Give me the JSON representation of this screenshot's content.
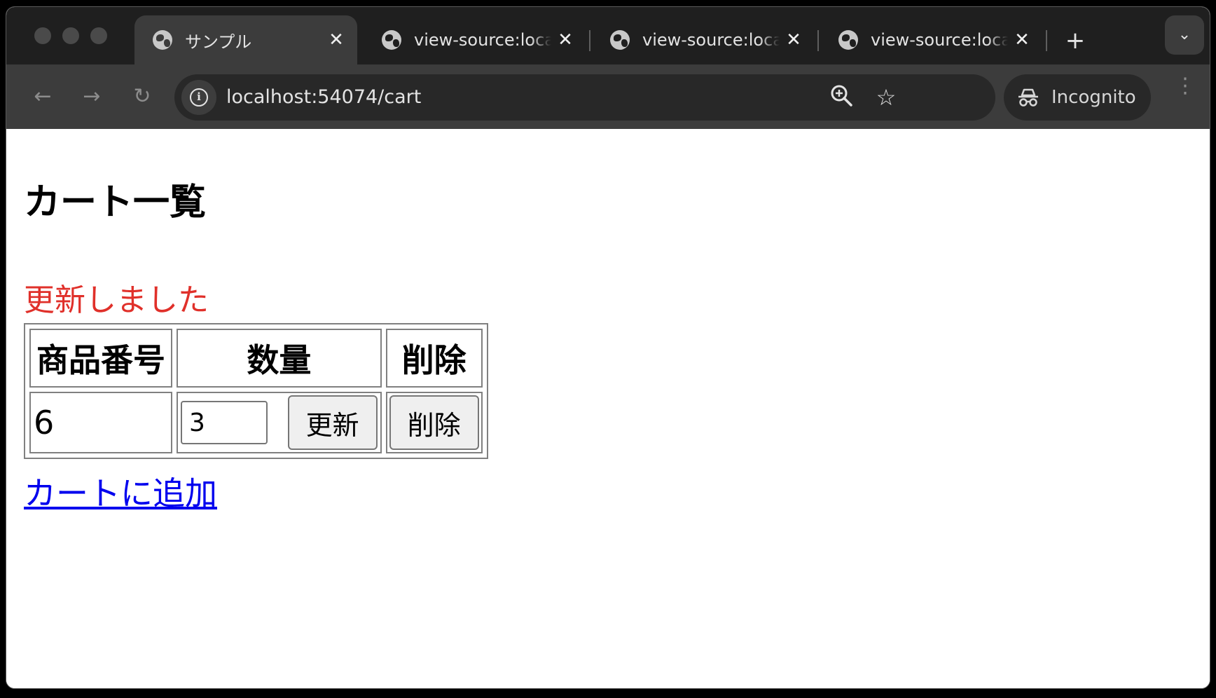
{
  "browser": {
    "tabs": [
      {
        "title": "サンプル",
        "active": true
      },
      {
        "title": "view-source:localhost:54074/cart",
        "active": false
      },
      {
        "title": "view-source:localhost:54074/cart",
        "active": false
      },
      {
        "title": "view-source:localhost:54074/cart",
        "active": false
      }
    ],
    "new_tab_label": "+",
    "url": "localhost:54074/cart",
    "profile_label": "Incognito"
  },
  "page": {
    "heading": "カート一覧",
    "message": "更新しました",
    "table": {
      "headers": [
        "商品番号",
        "数量",
        "削除"
      ],
      "rows": [
        {
          "product_id": "6",
          "quantity": "3",
          "update_label": "更新",
          "delete_label": "削除"
        }
      ]
    },
    "add_link": "カートに追加"
  },
  "colors": {
    "message": "#e0302a",
    "link": "#0000ee",
    "chrome_dark": "#1f1f1f",
    "chrome_toolbar": "#3c3c3c"
  }
}
